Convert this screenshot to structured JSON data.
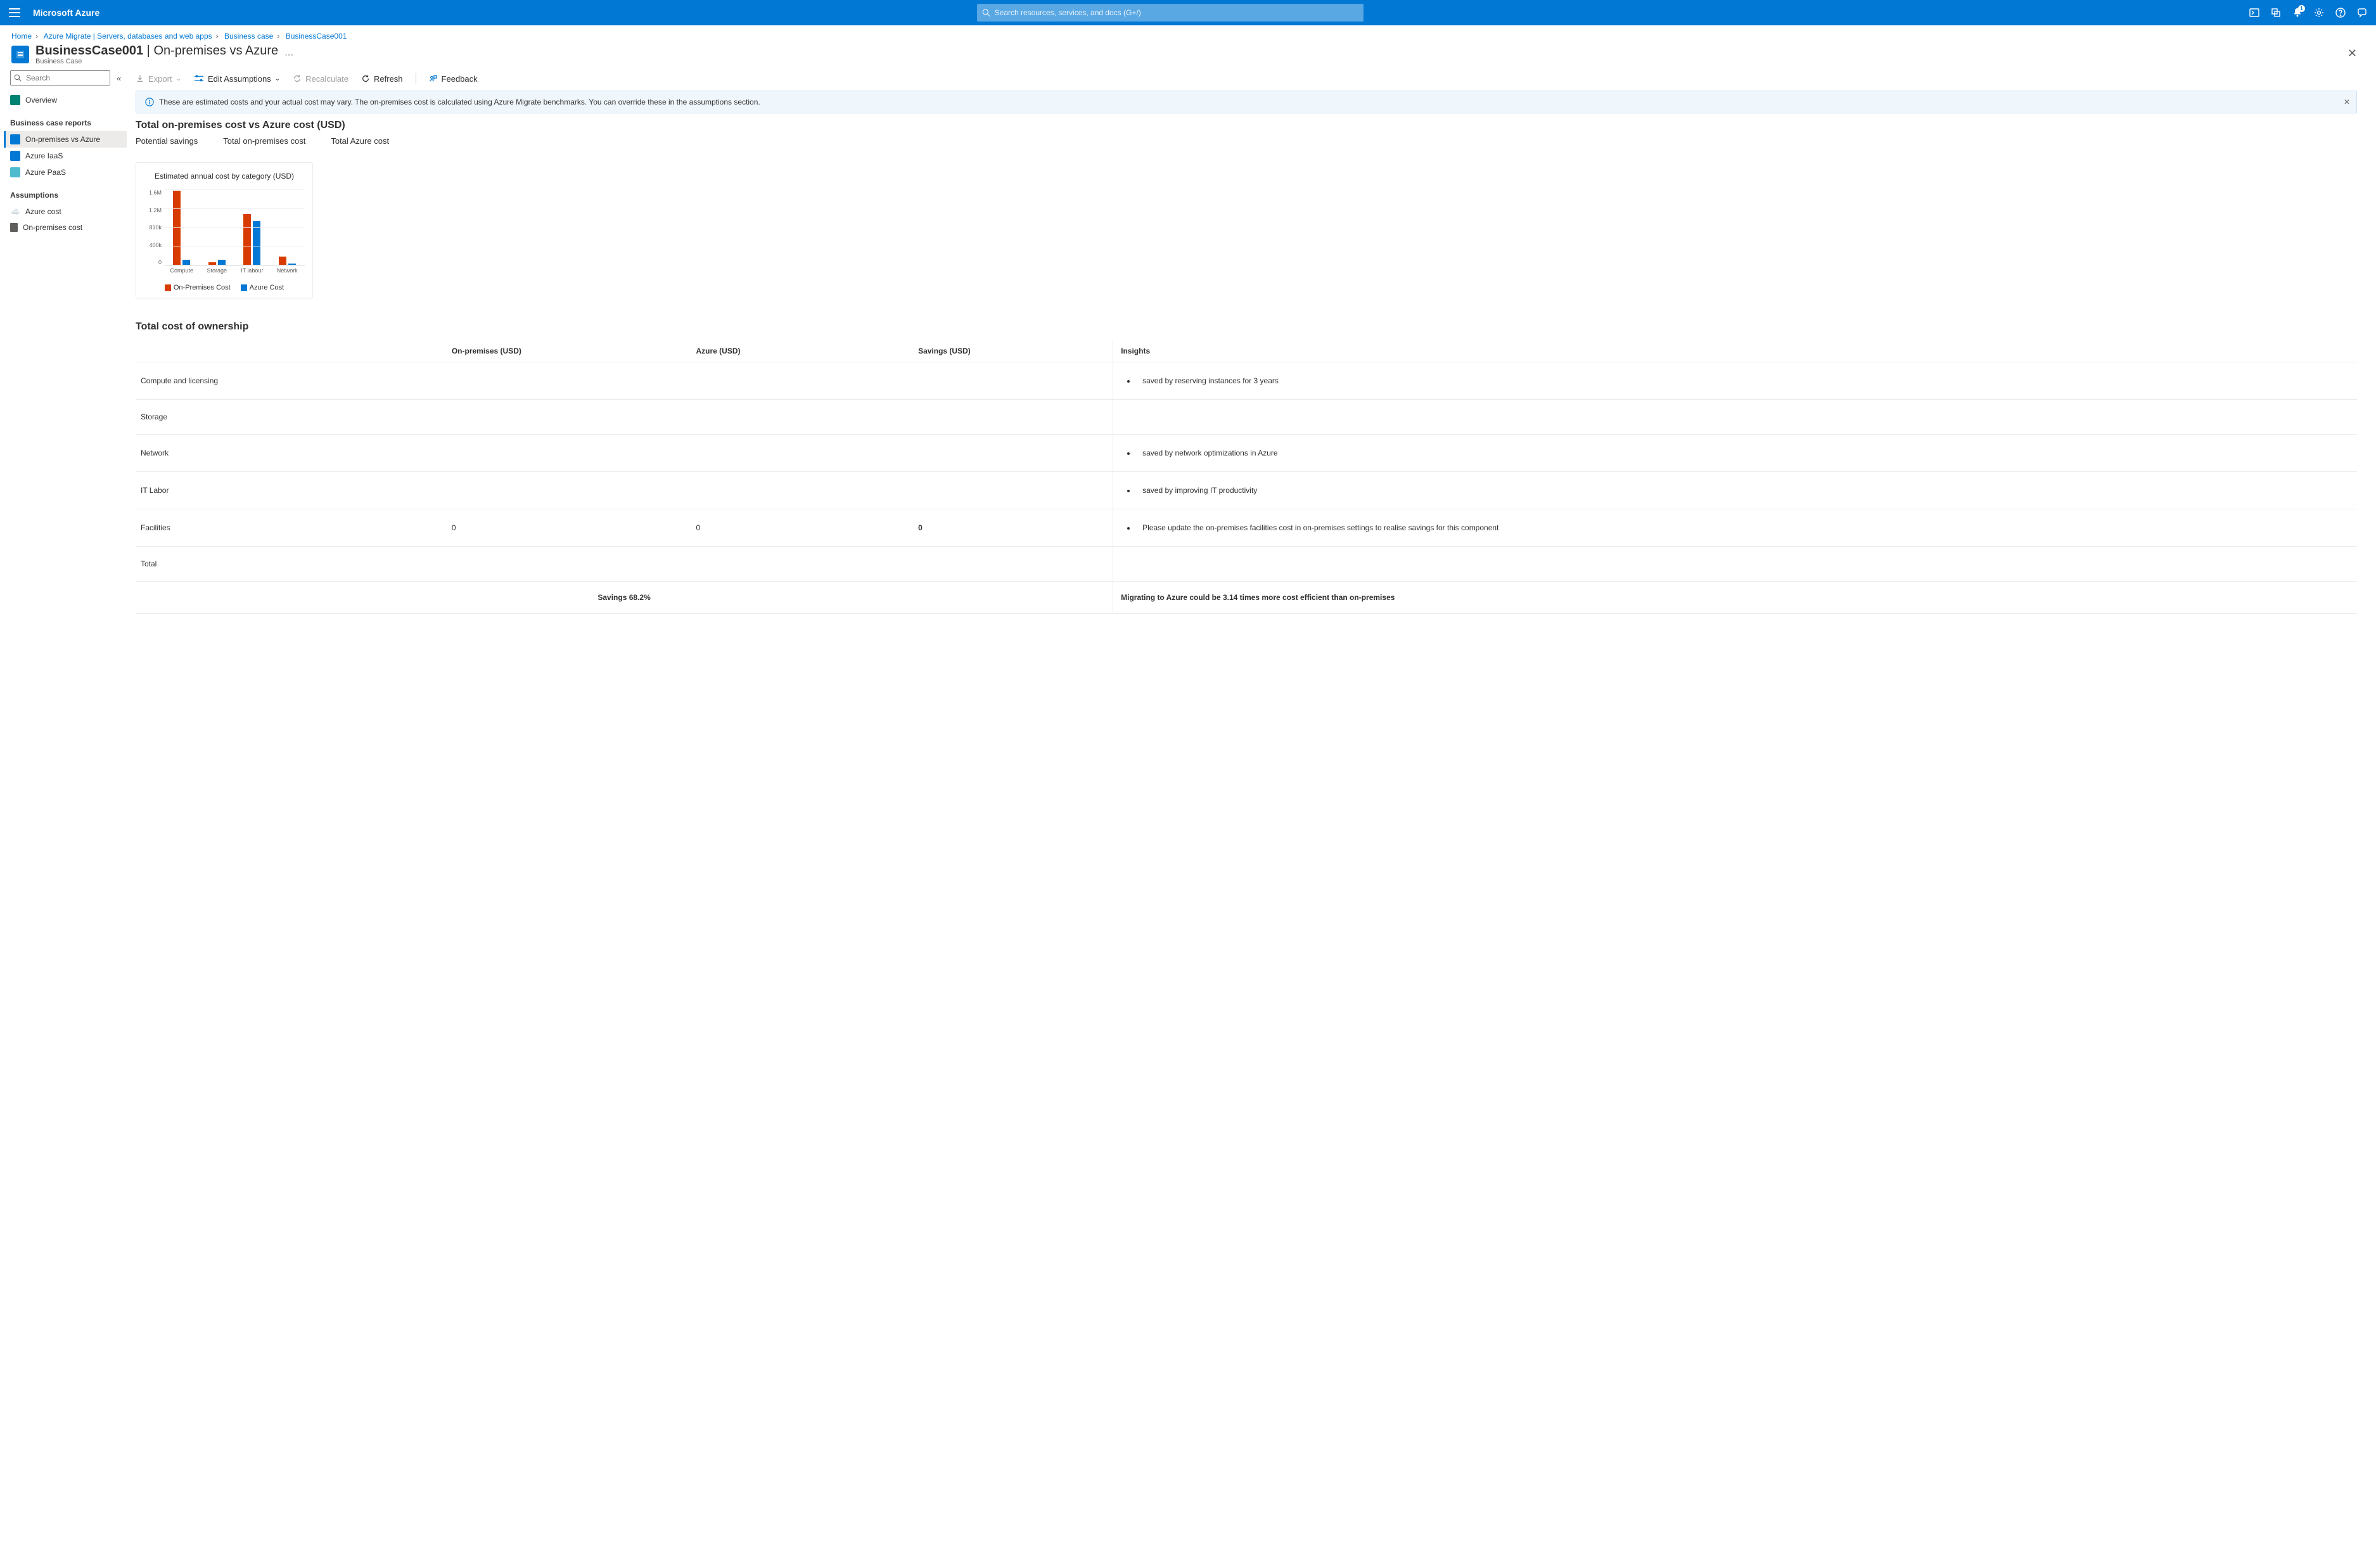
{
  "topbar": {
    "brand": "Microsoft Azure",
    "search_placeholder": "Search resources, services, and docs (G+/)",
    "notification_badge": "1"
  },
  "breadcrumb": {
    "items": [
      "Home",
      "Azure Migrate | Servers, databases and web apps",
      "Business case",
      "BusinessCase001"
    ]
  },
  "title": {
    "main": "BusinessCase001",
    "suffix": "On-premises vs Azure",
    "subtitle": "Business Case"
  },
  "sidebar": {
    "search_placeholder": "Search",
    "overview": "Overview",
    "group_reports": "Business case reports",
    "reports": [
      "On-premises vs Azure",
      "Azure IaaS",
      "Azure PaaS"
    ],
    "group_assumptions": "Assumptions",
    "assumptions": [
      "Azure cost",
      "On-premises cost"
    ]
  },
  "toolbar": {
    "export": "Export",
    "edit": "Edit Assumptions",
    "recalc": "Recalculate",
    "refresh": "Refresh",
    "feedback": "Feedback"
  },
  "banner": "These are estimated costs and your actual cost may vary. The on-premises cost is calculated using Azure Migrate benchmarks. You can override these in the assumptions section.",
  "section": {
    "heading": "Total on-premises cost vs Azure cost (USD)",
    "tabs": [
      "Potential savings",
      "Total on-premises cost",
      "Total Azure cost"
    ]
  },
  "chart_data": {
    "type": "bar",
    "title": "Estimated annual cost by category (USD)",
    "categories": [
      "Compute",
      "Storage",
      "IT labour",
      "Network"
    ],
    "yticks": [
      "1.6M",
      "1.2M",
      "810k",
      "400k",
      "0"
    ],
    "ylim": [
      0,
      1600000
    ],
    "series": [
      {
        "name": "On-Premises Cost",
        "color": "#d83b01",
        "values": [
          1580000,
          60000,
          1080000,
          180000
        ]
      },
      {
        "name": "Azure Cost",
        "color": "#0078d4",
        "values": [
          110000,
          110000,
          930000,
          30000
        ]
      }
    ]
  },
  "tco": {
    "heading": "Total cost of ownership",
    "columns": [
      "",
      "On-premises (USD)",
      "Azure (USD)",
      "Savings (USD)",
      "Insights"
    ],
    "rows": [
      {
        "label": "Compute and licensing",
        "onprem": "",
        "azure": "",
        "savings": "",
        "insights": [
          "saved by reserving instances for 3 years"
        ]
      },
      {
        "label": "Storage",
        "onprem": "",
        "azure": "",
        "savings": "",
        "insights": []
      },
      {
        "label": "Network",
        "onprem": "",
        "azure": "",
        "savings": "",
        "insights": [
          "saved by network optimizations in Azure"
        ]
      },
      {
        "label": "IT Labor",
        "onprem": "",
        "azure": "",
        "savings": "",
        "insights": [
          "saved by improving IT productivity"
        ]
      },
      {
        "label": "Facilities",
        "onprem": "0",
        "azure": "0",
        "savings": "0",
        "insights": [
          "Please update the on-premises facilities cost in on-premises settings to realise savings for this component"
        ]
      },
      {
        "label": "Total",
        "onprem": "",
        "azure": "",
        "savings": "",
        "insights": []
      }
    ],
    "summary_savings": "Savings 68.2%",
    "summary_insight": "Migrating to Azure could be 3.14 times more cost efficient than on-premises"
  }
}
